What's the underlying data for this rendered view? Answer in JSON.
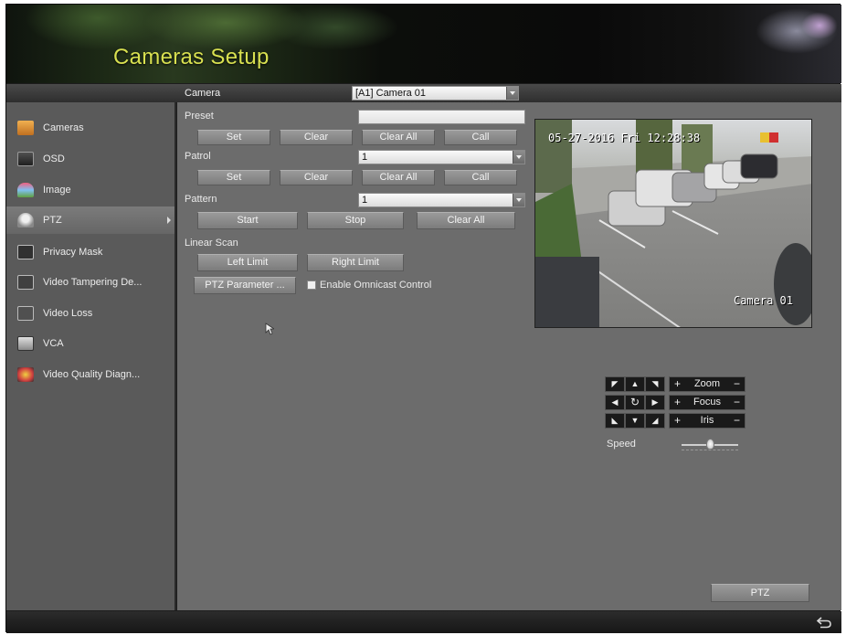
{
  "header": {
    "title": "Cameras Setup"
  },
  "topbar": {
    "camera_label": "Camera",
    "camera_value": "[A1] Camera 01"
  },
  "sidebar": {
    "items": [
      {
        "label": "Cameras",
        "icon": "cameras-icon"
      },
      {
        "label": "OSD",
        "icon": "osd-icon"
      },
      {
        "label": "Image",
        "icon": "image-icon"
      },
      {
        "label": "PTZ",
        "icon": "ptz-icon"
      },
      {
        "label": "Privacy Mask",
        "icon": "privacy-mask-icon"
      },
      {
        "label": "Video Tampering De...",
        "icon": "video-tampering-icon"
      },
      {
        "label": "Video Loss",
        "icon": "video-loss-icon"
      },
      {
        "label": "VCA",
        "icon": "vca-icon"
      },
      {
        "label": "Video Quality Diagn...",
        "icon": "video-quality-icon"
      }
    ],
    "active_index": 3
  },
  "main": {
    "preset": {
      "label": "Preset",
      "value": "",
      "buttons": [
        "Set",
        "Clear",
        "Clear All",
        "Call"
      ]
    },
    "patrol": {
      "label": "Patrol",
      "value": "1",
      "buttons": [
        "Set",
        "Clear",
        "Clear All",
        "Call"
      ]
    },
    "pattern": {
      "label": "Pattern",
      "value": "1",
      "buttons": [
        "Start",
        "Stop",
        "Clear All"
      ]
    },
    "linear_scan": {
      "label": "Linear Scan",
      "left": "Left Limit",
      "right": "Right Limit"
    },
    "ptz_parameter": "PTZ Parameter ...",
    "omnicast": {
      "label": "Enable Omnicast Control",
      "checked": false
    }
  },
  "preview": {
    "timestamp": "05-27-2016 Fri 12:28:38",
    "camera_name": "Camera 01"
  },
  "ptz_control": {
    "zoom": "Zoom",
    "focus": "Focus",
    "iris": "Iris",
    "speed_label": "Speed",
    "speed_level": 0.5
  },
  "footer": {
    "ptz_button": "PTZ"
  },
  "colors": {
    "header_title": "#d8e050",
    "panel": "#6c6c6c",
    "sidebar": "#5a5a5a"
  }
}
